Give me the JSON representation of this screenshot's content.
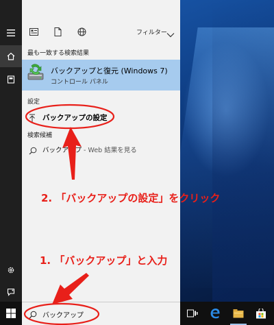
{
  "filter_bar": {
    "icons": [
      "documents-icon",
      "file-icon",
      "globe-icon"
    ],
    "filter_label": "フィルター"
  },
  "results": {
    "best_match_header": "最も一致する検索結果",
    "best_match": {
      "title": "バックアップと復元 (Windows 7)",
      "subtitle": "コントロール パネル",
      "icon": "backup-restore-icon"
    },
    "settings_header": "設定",
    "settings_item": {
      "label": "バックアップの設定",
      "icon": "upload-arrow-icon"
    },
    "web_header": "検索候補",
    "web_item": {
      "query": "バックアップ",
      "suffix": " - Web 結果を見る",
      "icon": "search-icon"
    }
  },
  "search": {
    "value": "バックアップ"
  },
  "annotations": {
    "step1": "1. 「バックアップ」と入力",
    "step2": "2. 「バックアップの設定」をクリック",
    "color": "#e8201a"
  },
  "colors": {
    "highlight": "#a6cbee",
    "panel": "#f2f2f2",
    "rail": "#1f1f1f",
    "taskbar": "#101010"
  },
  "taskbar": {
    "icons": [
      "task-view-icon",
      "edge-icon",
      "file-explorer-icon",
      "store-icon"
    ]
  }
}
